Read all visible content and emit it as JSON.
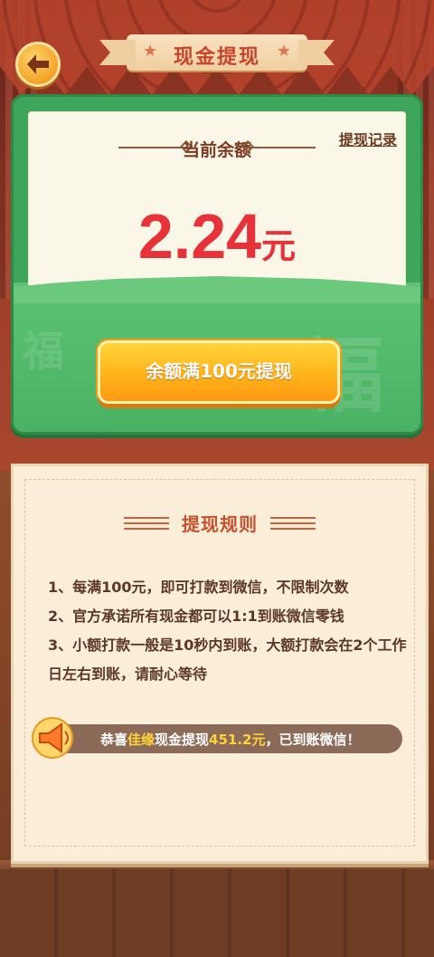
{
  "header": {
    "title": "现金提现"
  },
  "balance": {
    "label": "当前余额",
    "record_link": "提现记录",
    "amount": "2.24",
    "unit": "元"
  },
  "withdraw_button": "余额满100元提现",
  "rules": {
    "title": "提现规则",
    "items": [
      "1、每满100元，即可打款到微信，不限制次数",
      "2、官方承诺所有现金都可以1:1到账微信零钱",
      "3、小额打款一般是10秒内到账，大额打款会在2个工作日左右到账，请耐心等待"
    ]
  },
  "ticker": {
    "prefix": "恭喜",
    "name": "佳缘",
    "middle": "现金提现",
    "amount": "451.2元",
    "suffix": "，已到账微信！"
  },
  "colors": {
    "accent_red": "#e8323a",
    "card_green": "#3ea65a",
    "button_orange": "#ffb31a"
  }
}
